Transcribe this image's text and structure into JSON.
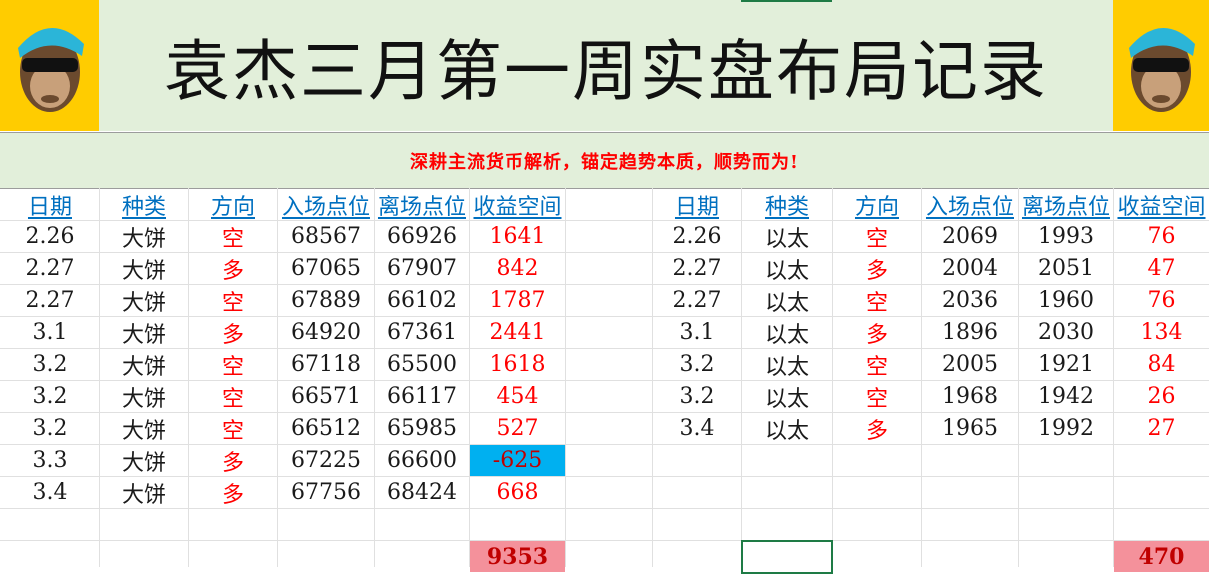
{
  "title": "袁杰三月第一周实盘布局记录",
  "subtitle": "深耕主流货币解析，锚定趋势本质，顺势而为!",
  "logo_left": "monkey-with-sunglasses-logo",
  "logo_right": "monkey-with-sunglasses-logo",
  "colors": {
    "banner_bg": "#e2efda",
    "logo_bg": "#ffcc00",
    "header_text": "#0070c0",
    "profit_text": "#ff0000",
    "negative_cell_bg": "#00b0f0",
    "total_bg": "#f4919b",
    "selection_border": "#1e7b45"
  },
  "left_table": {
    "headers": [
      "日期",
      "种类",
      "方向",
      "入场点位",
      "离场点位",
      "收益空间"
    ],
    "rows": [
      [
        "2.26",
        "大饼",
        "空",
        "68567",
        "66926",
        "1641"
      ],
      [
        "2.27",
        "大饼",
        "多",
        "67065",
        "67907",
        "842"
      ],
      [
        "2.27",
        "大饼",
        "空",
        "67889",
        "66102",
        "1787"
      ],
      [
        "3.1",
        "大饼",
        "多",
        "64920",
        "67361",
        "2441"
      ],
      [
        "3.2",
        "大饼",
        "空",
        "67118",
        "65500",
        "1618"
      ],
      [
        "3.2",
        "大饼",
        "空",
        "66571",
        "66117",
        "454"
      ],
      [
        "3.2",
        "大饼",
        "空",
        "66512",
        "65985",
        "527"
      ],
      [
        "3.3",
        "大饼",
        "多",
        "67225",
        "66600",
        "-625"
      ],
      [
        "3.4",
        "大饼",
        "多",
        "67756",
        "68424",
        "668"
      ]
    ],
    "total": "9353"
  },
  "right_table": {
    "headers": [
      "日期",
      "种类",
      "方向",
      "入场点位",
      "离场点位",
      "收益空间"
    ],
    "rows": [
      [
        "2.26",
        "以太",
        "空",
        "2069",
        "1993",
        "76"
      ],
      [
        "2.27",
        "以太",
        "多",
        "2004",
        "2051",
        "47"
      ],
      [
        "2.27",
        "以太",
        "空",
        "2036",
        "1960",
        "76"
      ],
      [
        "3.1",
        "以太",
        "多",
        "1896",
        "2030",
        "134"
      ],
      [
        "3.2",
        "以太",
        "空",
        "2005",
        "1921",
        "84"
      ],
      [
        "3.2",
        "以太",
        "空",
        "1968",
        "1942",
        "26"
      ],
      [
        "3.4",
        "以太",
        "多",
        "1965",
        "1992",
        "27"
      ]
    ],
    "total": "470"
  }
}
